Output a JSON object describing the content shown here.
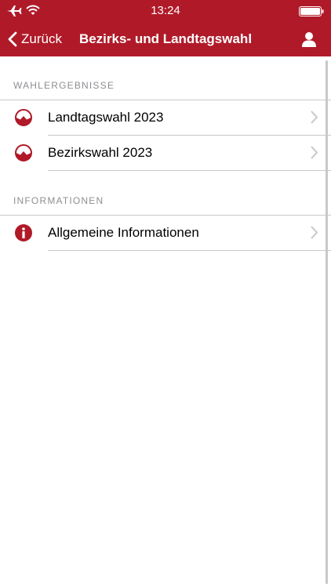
{
  "status_bar": {
    "time": "13:24",
    "icons": [
      "airplane-icon",
      "wifi-icon",
      "battery-icon"
    ]
  },
  "nav": {
    "back_label": "Zurück",
    "title": "Bezirks- und Landtagswahl",
    "right_icon": "user-icon"
  },
  "colors": {
    "brand": "#b01a28",
    "separator": "#c8c7cc",
    "section_header": "#8e8e93",
    "chevron": "#c7c7cc"
  },
  "sections": [
    {
      "header": "WAHLERGEBNISSE",
      "items": [
        {
          "label": "Landtagswahl 2023",
          "icon": "election-logo-icon"
        },
        {
          "label": "Bezirkswahl 2023",
          "icon": "election-logo-icon"
        }
      ]
    },
    {
      "header": "INFORMATIONEN",
      "items": [
        {
          "label": "Allgemeine Informationen",
          "icon": "info-icon"
        }
      ]
    }
  ]
}
